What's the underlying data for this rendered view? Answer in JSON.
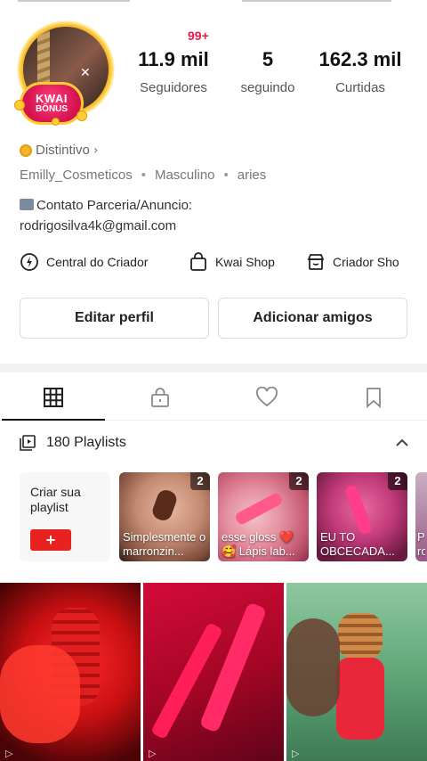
{
  "profile": {
    "notif_badge": "99+",
    "avatar_badge_line1": "KWAI",
    "avatar_badge_line2": "BÔNUS",
    "stats": [
      {
        "value": "11.9 mil",
        "label": "Seguidores"
      },
      {
        "value": "5",
        "label": "seguindo"
      },
      {
        "value": "162.3 mil",
        "label": "Curtidas"
      }
    ],
    "badge_label": "Distintivo",
    "username": "Emilly_Cosmeticos",
    "gender": "Masculino",
    "sign": "aries",
    "bio_line1": "Contato Parceria/Anuncio:",
    "bio_line2": "rodrigosilva4k@gmail.com"
  },
  "links": [
    {
      "label": "Central do Criador",
      "icon": "bolt-icon"
    },
    {
      "label": "Kwai Shop",
      "icon": "shopping-bag-icon"
    },
    {
      "label": "Criador Sho",
      "icon": "store-icon"
    }
  ],
  "buttons": {
    "edit": "Editar perfil",
    "add_friends": "Adicionar amigos"
  },
  "tabs": [
    "grid-icon",
    "lock-icon",
    "heart-icon",
    "bookmark-icon"
  ],
  "playlists": {
    "header": "180 Playlists",
    "create_label": "Criar sua playlist",
    "create_button": "+",
    "items": [
      {
        "count": "2",
        "caption": "Simplesmente o marronzin..."
      },
      {
        "count": "2",
        "caption": "esse gloss ❤️ 🥰 Lápis lab..."
      },
      {
        "count": "2",
        "caption": "EU TO OBCECADA..."
      }
    ],
    "partial_caption": "P ro"
  },
  "colors": {
    "accent_red": "#e8231f",
    "notif_pink": "#e8194a",
    "badge_gold": "#ffcc33"
  }
}
